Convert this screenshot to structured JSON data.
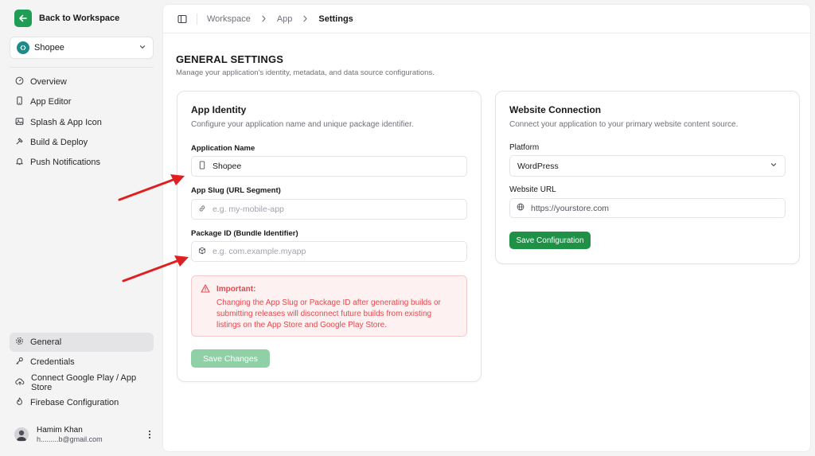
{
  "sidebar": {
    "back_label": "Back to Workspace",
    "app_selector": {
      "value": "Shopee"
    },
    "nav_top": [
      {
        "label": "Overview",
        "icon": "gauge-icon"
      },
      {
        "label": "App Editor",
        "icon": "smartphone-icon"
      },
      {
        "label": "Splash & App Icon",
        "icon": "image-icon"
      },
      {
        "label": "Build & Deploy",
        "icon": "hammer-icon"
      },
      {
        "label": "Push Notifications",
        "icon": "bell-icon"
      }
    ],
    "nav_bottom": [
      {
        "label": "General",
        "icon": "gear-icon",
        "active": true
      },
      {
        "label": "Credentials",
        "icon": "key-icon"
      },
      {
        "label": "Connect Google Play / App Store",
        "icon": "cloud-upload-icon"
      },
      {
        "label": "Firebase Configuration",
        "icon": "flame-icon"
      }
    ],
    "user": {
      "name": "Hamim Khan",
      "email": "h.........b@gmail.com"
    }
  },
  "breadcrumb": {
    "items": [
      "Workspace",
      "App"
    ],
    "current": "Settings"
  },
  "page": {
    "title": "GENERAL SETTINGS",
    "subtitle": "Manage your application's identity, metadata, and data source configurations."
  },
  "app_identity": {
    "title": "App Identity",
    "description": "Configure your application name and unique package identifier.",
    "app_name_label": "Application Name",
    "app_name_value": "Shopee",
    "slug_label": "App Slug (URL Segment)",
    "slug_placeholder": "e.g. my-mobile-app",
    "package_label": "Package ID (Bundle Identifier)",
    "package_placeholder": "e.g. com.example.myapp",
    "alert_title": "Important:",
    "alert_body": "Changing the App Slug or Package ID after generating builds or submitting releases will disconnect future builds from existing listings on the App Store and Google Play Store.",
    "save_label": "Save Changes"
  },
  "website_connection": {
    "title": "Website Connection",
    "description": "Connect your application to your primary website content source.",
    "platform_label": "Platform",
    "platform_value": "WordPress",
    "url_label": "Website URL",
    "url_placeholder": "https://yourstore.com",
    "save_label": "Save Configuration"
  },
  "colors": {
    "accent": "#1f9146",
    "accent_disabled": "#8fd0a7",
    "danger": "#e5484d",
    "danger_bg": "#fdf1f1",
    "annotation_arrow": "#e02020"
  }
}
